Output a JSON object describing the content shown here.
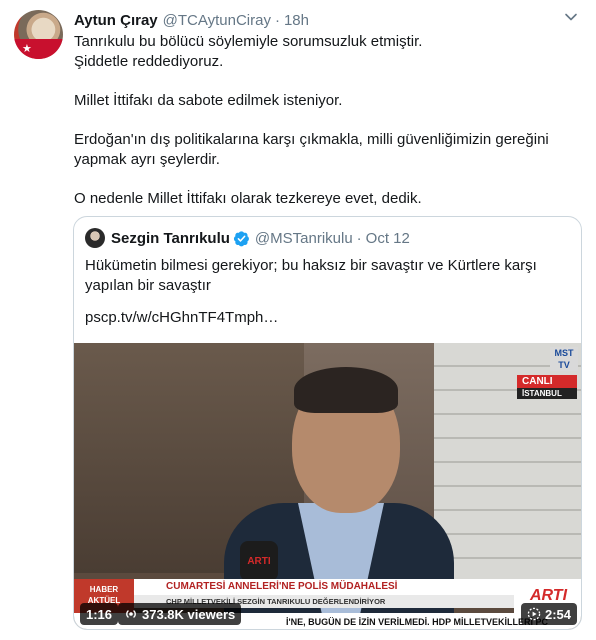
{
  "tweet": {
    "author_name": "Aytun Çıray",
    "author_handle": "@TCAytunCiray",
    "separator": "·",
    "time": "18h",
    "paragraphs": [
      "Tanrıkulu bu bölücü söylemiyle sorumsuzluk etmiştir.\nŞiddetle reddediyoruz.",
      "Millet İttifakı da sabote edilmek isteniyor.",
      "Erdoğan'ın dış politikalarına karşı çıkmakla, milli güvenliğimizin gereğini yapmak ayrı şeylerdir.",
      "O nedenle Millet İttifakı olarak tezkereye evet, dedik."
    ]
  },
  "quoted_tweet": {
    "author_name": "Sezgin Tanrıkulu",
    "author_handle": "@MSTanrikulu",
    "separator": "·",
    "time": "Oct 12",
    "text": "Hükümetin bilmesi gerekiyor; bu haksız bir savaştır ve Kürtlere karşı yapılan bir savaştır",
    "link": "pscp.tv/w/cHGhnTF4Tmph…",
    "video": {
      "channel_logo": "MST TV",
      "live_label": "CANLI",
      "location_label": "İSTANBUL",
      "mic_label": "ARTI",
      "lower_third_tag": "HABER AKTÜEL",
      "lower_third_title": "CUMARTESİ ANNELERİ'NE POLİS MÜDAHALESİ",
      "lower_third_subtitle": "CHP MİLLETVEKİLİ SEZGİN TANRIKULU DEĞERLENDİRİYOR",
      "brand": "ARTI",
      "ticker": "İ'NE, BUGÜN DE İZİN VERİLMEDİ. HDP MİLLETVEKİLLERİ PC",
      "elapsed": "1:16",
      "viewers": "373.8K viewers",
      "duration": "2:54"
    }
  },
  "colors": {
    "text": "#14171a",
    "secondary": "#657786",
    "border": "#ccd6dd",
    "verified": "#1da1f2",
    "live_red": "#d42a2a"
  }
}
